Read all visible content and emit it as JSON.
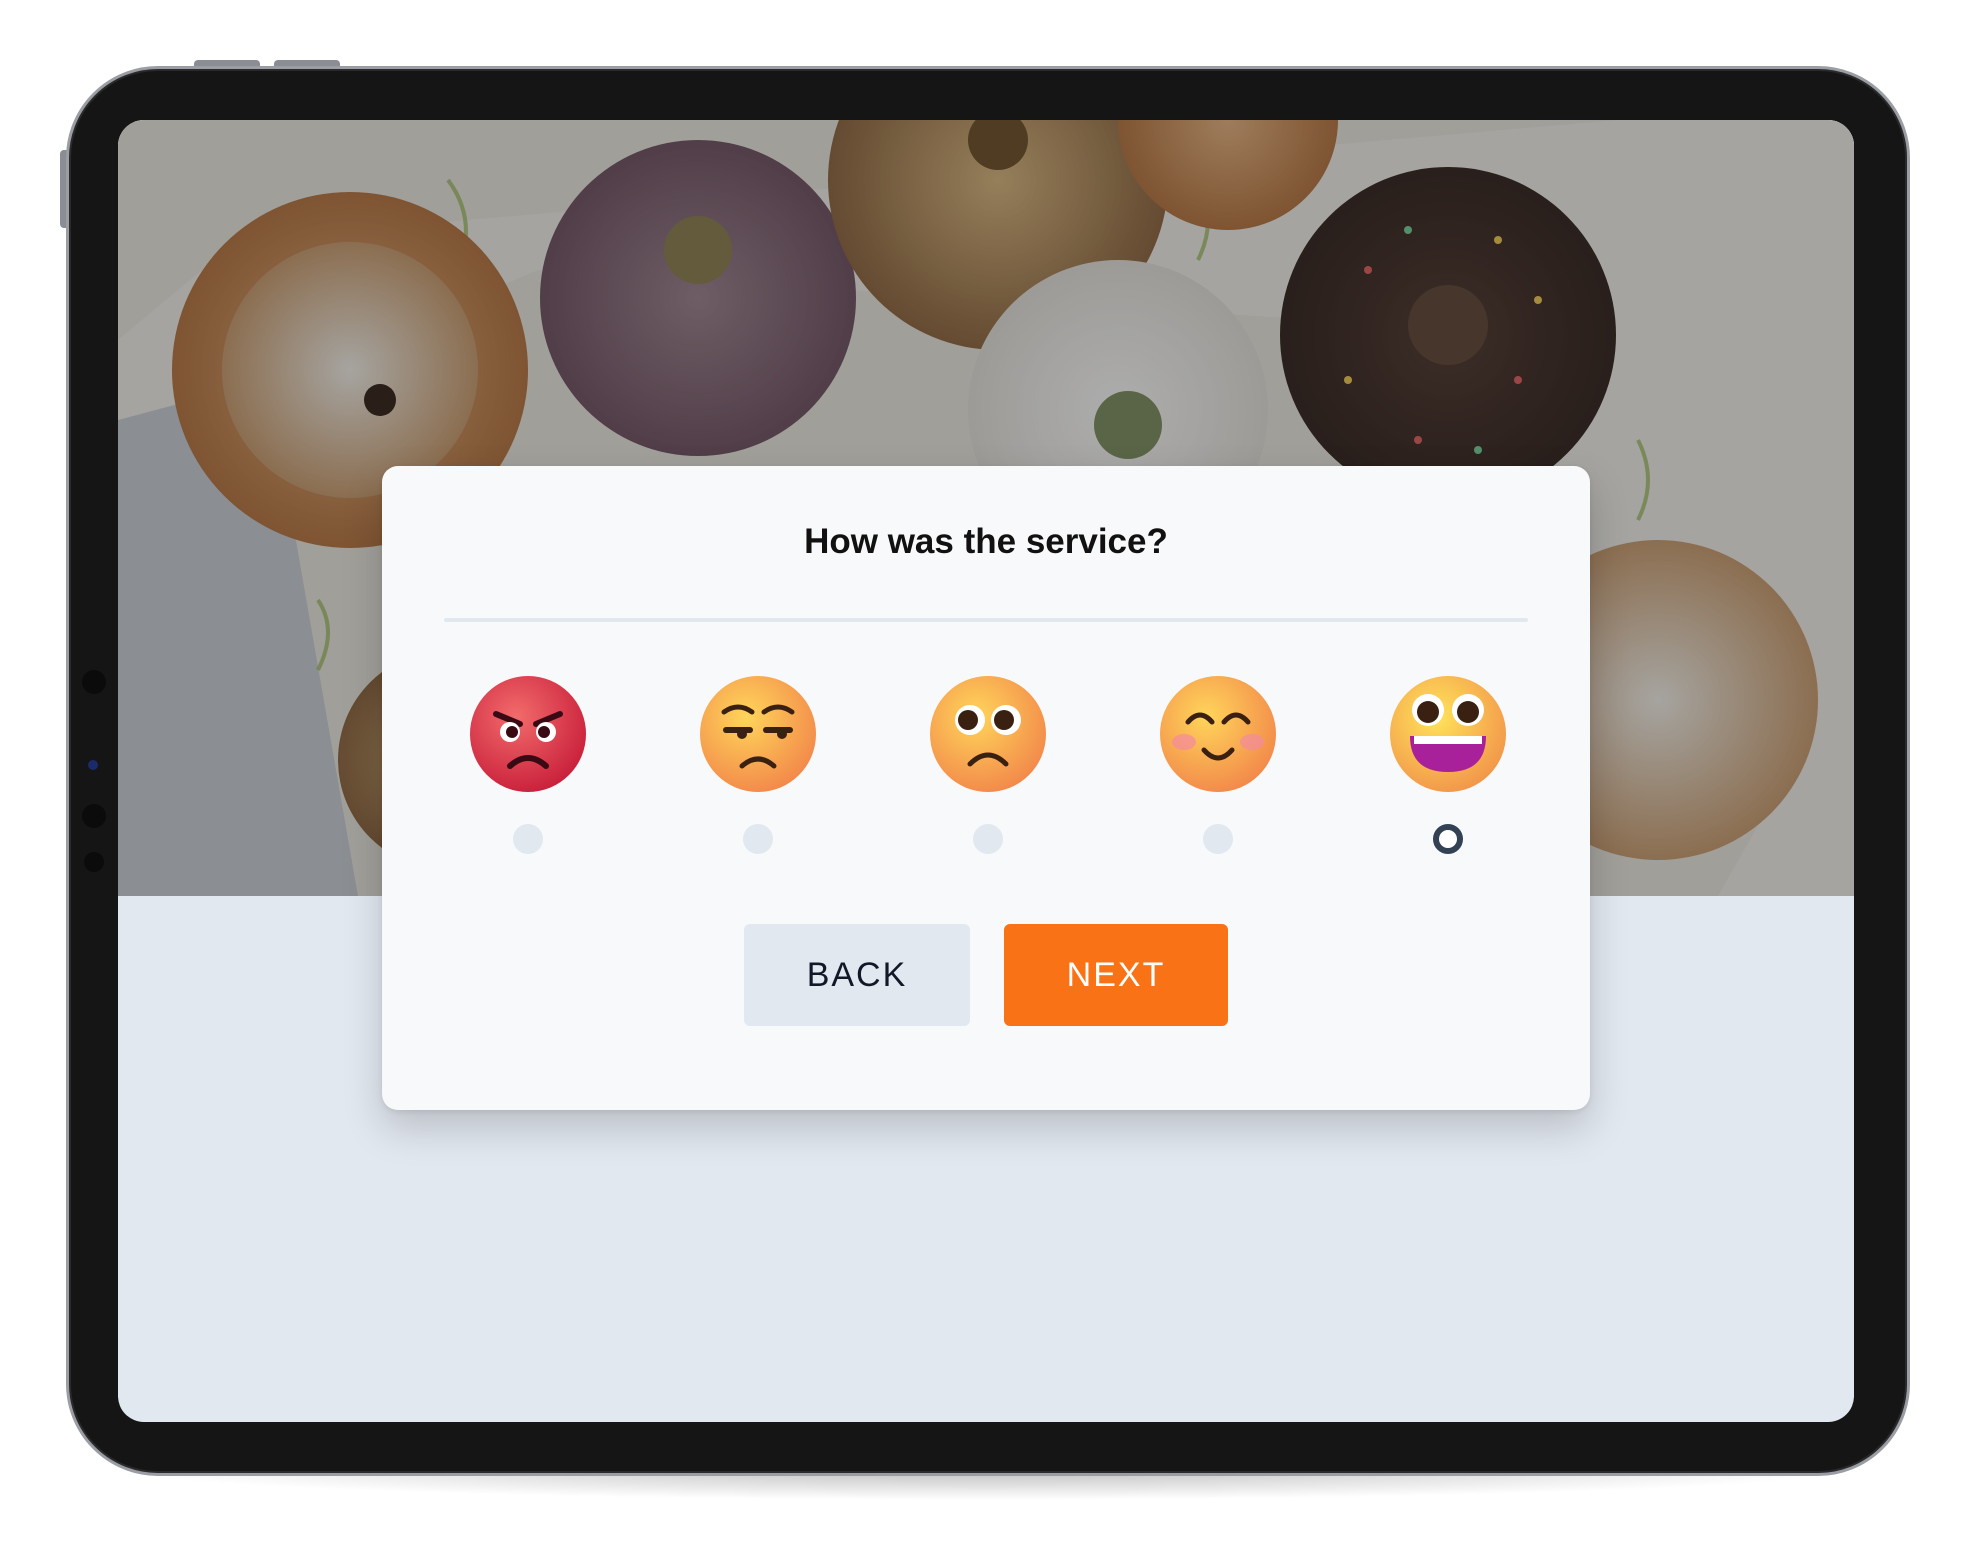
{
  "survey": {
    "question": "How was the service?",
    "options": [
      {
        "icon": "angry-face-icon",
        "selected": false
      },
      {
        "icon": "unamused-face-icon",
        "selected": false
      },
      {
        "icon": "frowning-face-icon",
        "selected": false
      },
      {
        "icon": "smiling-face-icon",
        "selected": false
      },
      {
        "icon": "grinning-face-icon",
        "selected": true
      }
    ],
    "back_label": "BACK",
    "next_label": "NEXT"
  },
  "colors": {
    "accent": "#f97316",
    "secondary_button": "#e2e8f0",
    "page_background": "#e2e8f0",
    "card_background": "#f8f9fb",
    "selected_radio": "#334155"
  }
}
